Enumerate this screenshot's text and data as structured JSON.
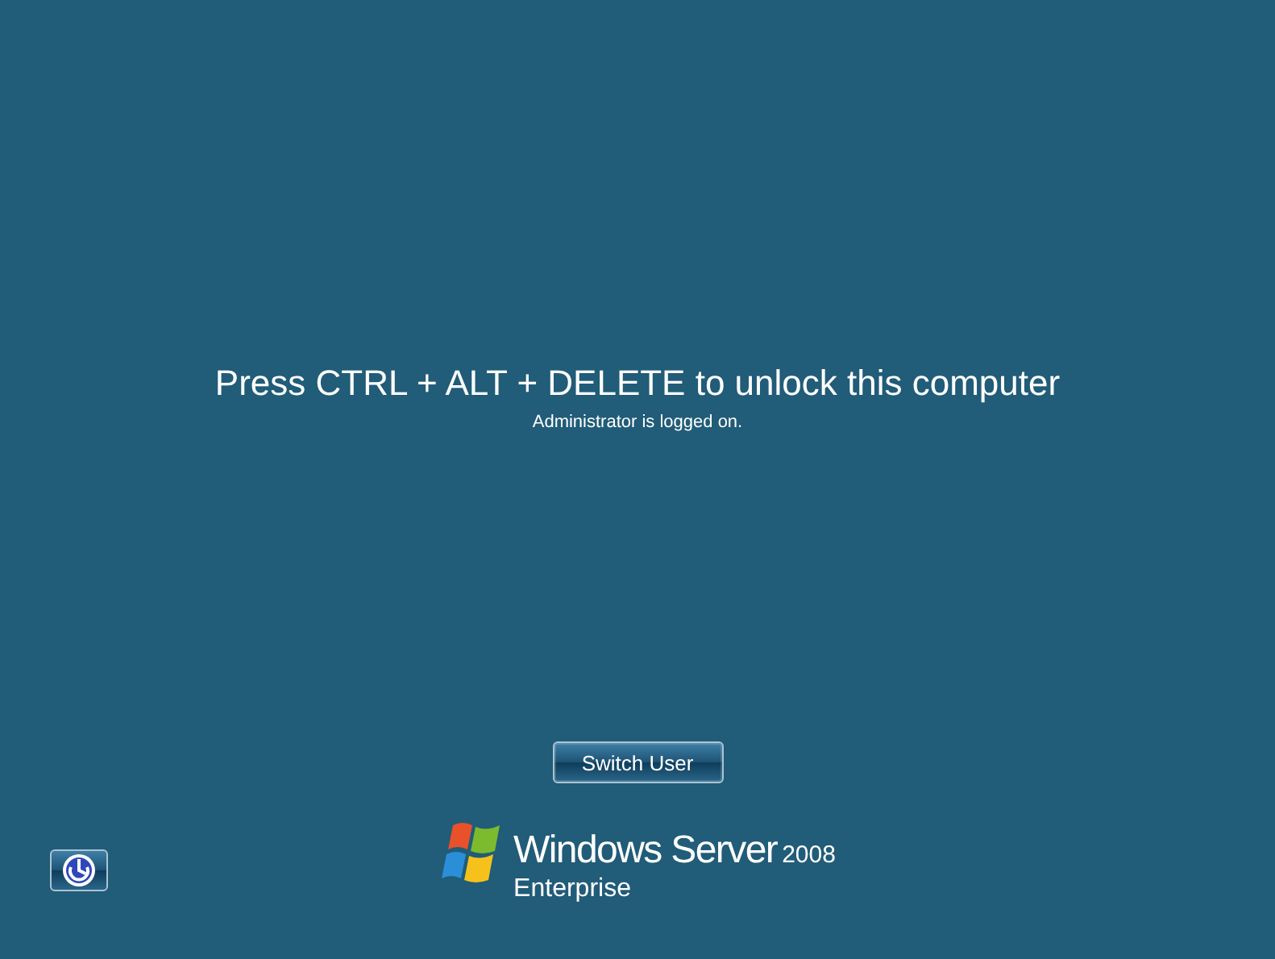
{
  "lock_screen": {
    "title": "Press CTRL + ALT + DELETE to unlock this computer",
    "status": "Administrator is logged on."
  },
  "buttons": [
    {
      "kind": "text",
      "label": "Switch User"
    }
  ],
  "ease_of_access_button": {
    "kind": "icon"
  },
  "brand": {
    "name": "Windows Server",
    "version": "2008",
    "edition": "Enterprise"
  }
}
